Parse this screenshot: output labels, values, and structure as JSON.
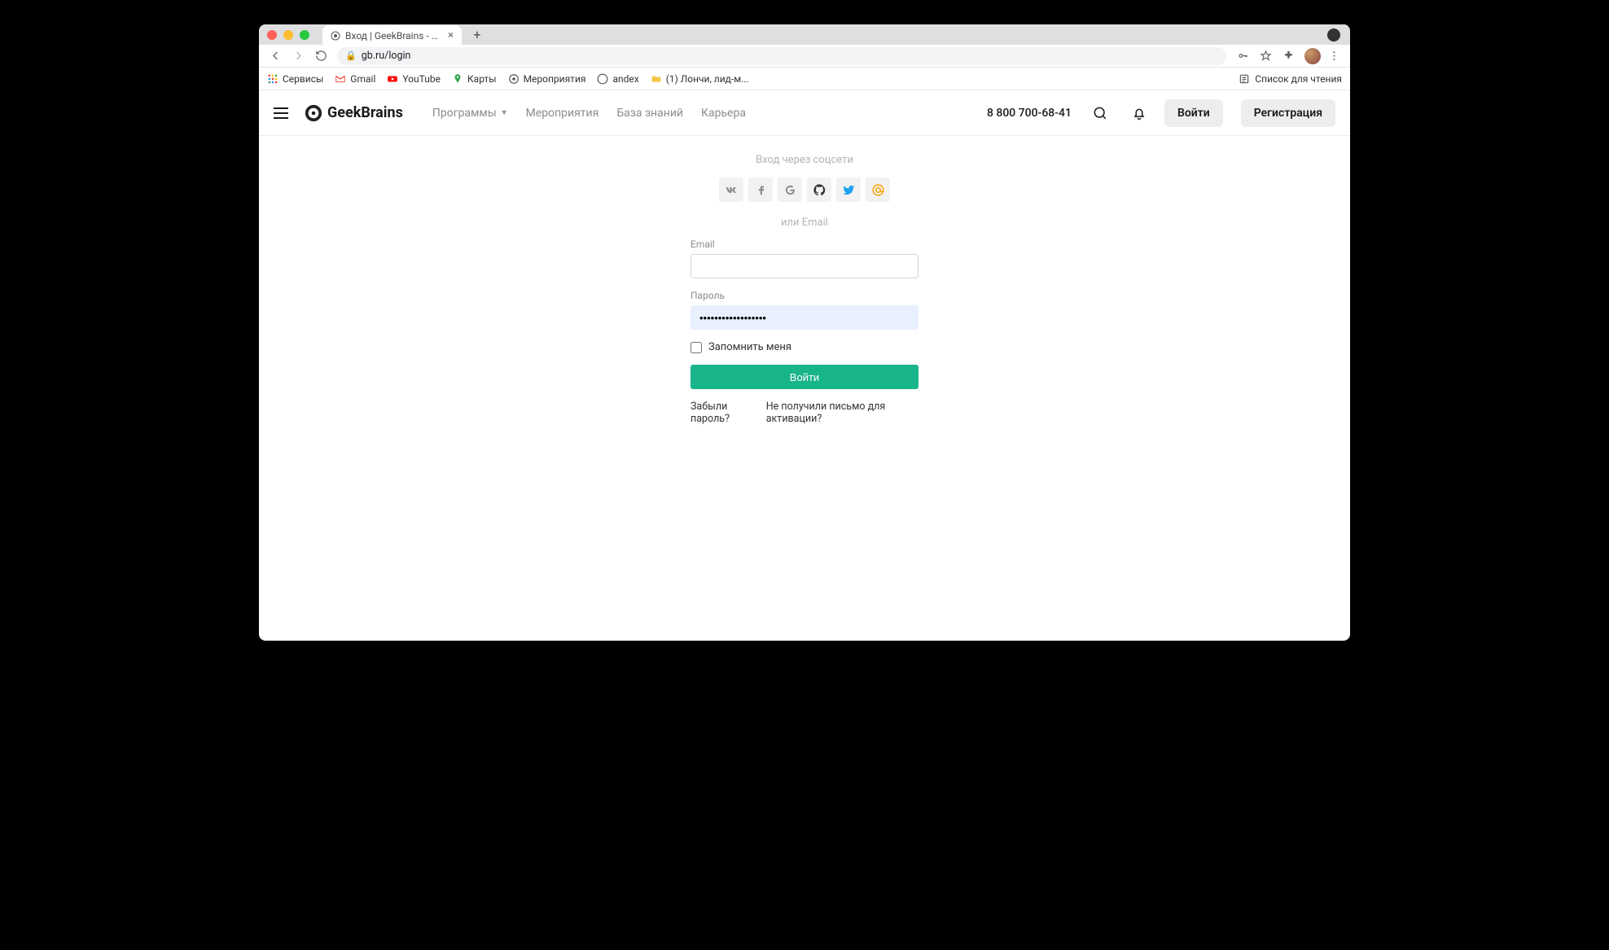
{
  "browser": {
    "tab_title": "Вход | GeekBrains - образова",
    "url": "gb.ru/login",
    "bookmarks": [
      {
        "label": "Сервисы",
        "icon": "grid-icon"
      },
      {
        "label": "Gmail",
        "icon": "gmail-icon"
      },
      {
        "label": "YouTube",
        "icon": "youtube-icon"
      },
      {
        "label": "Карты",
        "icon": "maps-icon"
      },
      {
        "label": "Мероприятия",
        "icon": "gb-icon"
      },
      {
        "label": "andex",
        "icon": "yandex-icon"
      },
      {
        "label": "(1) Лончи, лид-м...",
        "icon": "folder-icon"
      }
    ],
    "reading_list": "Список для чтения"
  },
  "header": {
    "brand": "GeekBrains",
    "nav": {
      "programs": "Программы",
      "events": "Мероприятия",
      "knowledge": "База знаний",
      "career": "Карьера"
    },
    "phone": "8 800 700-68-41",
    "login_button": "Войти",
    "register_button": "Регистрация"
  },
  "login": {
    "social_title": "Вход через соцсети",
    "divider": "или Email",
    "email_label": "Email",
    "email_value": "",
    "password_label": "Пароль",
    "password_value": "••••••••••••••••••",
    "remember_label": "Запомнить меня",
    "submit": "Войти",
    "forgot_password": "Забыли пароль?",
    "no_activation": "Не получили письмо для активации?"
  }
}
